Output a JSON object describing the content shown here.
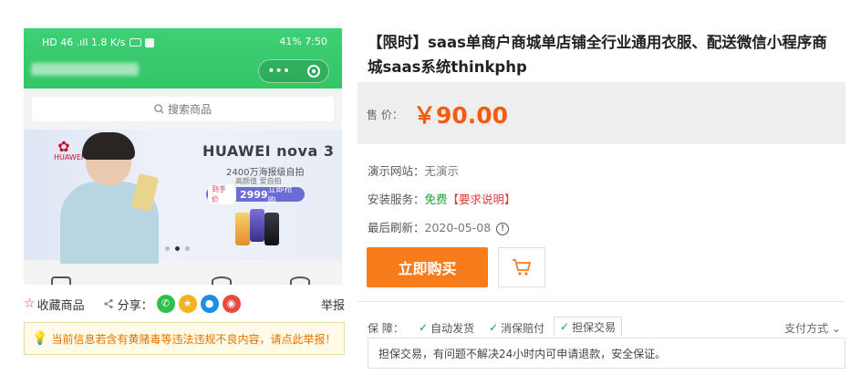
{
  "phone": {
    "status_left": "HD 46 .ıll 1.8 K/s",
    "status_right": "41%  7:50",
    "capsule_menu": "•••",
    "search_placeholder": "搜索商品",
    "banner": {
      "brand_logo_text": "HUAWEI",
      "model": "HUAWEI nova 3",
      "slogan": "2400万海报级自拍",
      "slogan2": "高颜值  爱自拍",
      "price_tag": "到手价",
      "price": "2999",
      "buy_label": "立即抢购"
    }
  },
  "actions": {
    "favorite": "收藏商品",
    "share": "分享：",
    "report": "举报"
  },
  "notice": "当前信息若含有黄赌毒等违法违规不良内容，请点此举报！",
  "product": {
    "title": "【限时】saas单商户商城单店铺全行业通用衣服、配送微信小程序商城saas系统thinkphp",
    "price_label": "售  价：",
    "price": "￥90.00",
    "demo_label": "演示网站：",
    "demo_value": "无演示",
    "install_label": "安装服务：",
    "install_value": "免费",
    "install_link": "【要求说明】",
    "refresh_label": "最后刷新：",
    "refresh_value": "2020-05-08",
    "info_icon": "!",
    "buy_label": "立即购买"
  },
  "guarantee": {
    "label": "保  障：",
    "tabs": [
      "自动发货",
      "消保赔付",
      "担保交易"
    ],
    "pay_mode": "支付方式",
    "description": "担保交易，有问题不解决24小时内可申请退款，安全保证。"
  },
  "colors": {
    "accent": "#f35b0e",
    "buy_button": "#f77c1c",
    "miniapp_green": "#3ed074",
    "link_red": "#e4393c",
    "free_green": "#1aa035"
  }
}
